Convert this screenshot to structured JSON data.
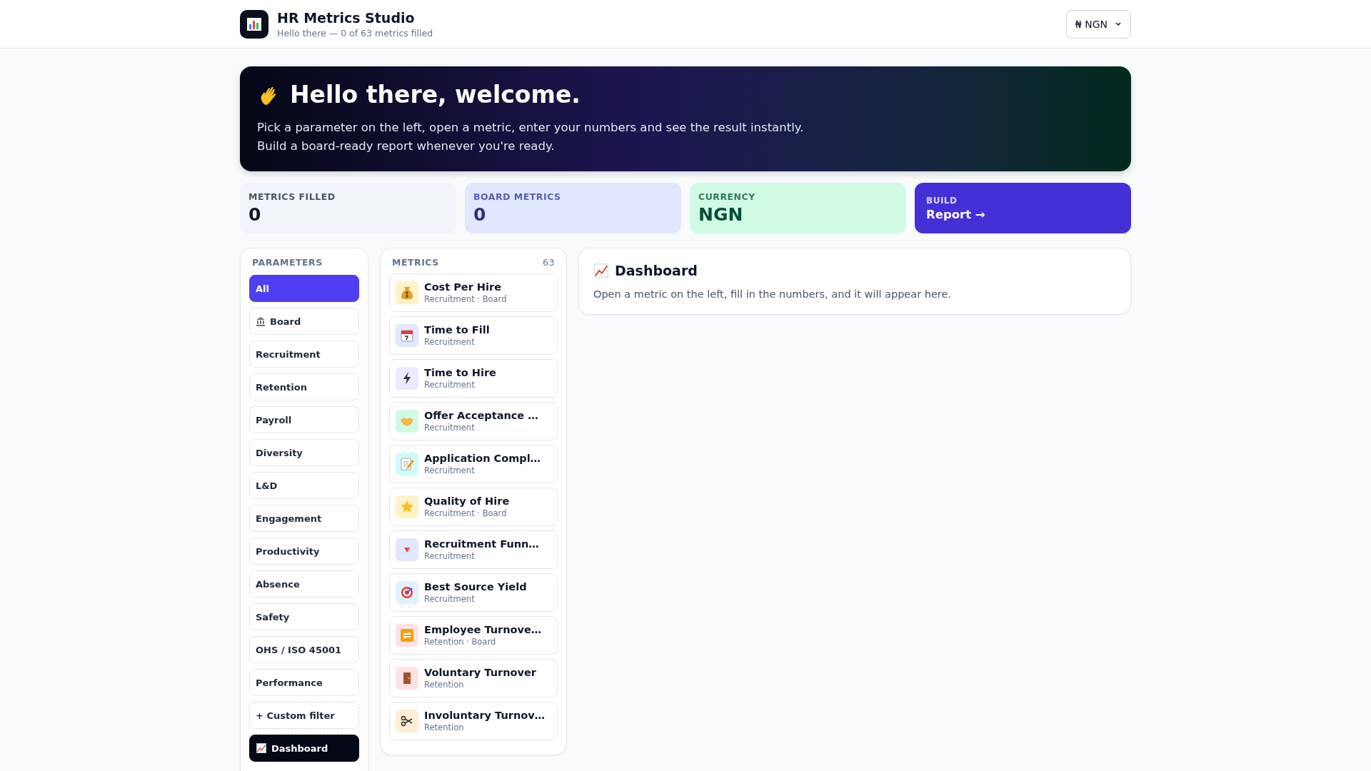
{
  "header": {
    "title": "HR Metrics Studio",
    "subtitle": "Hello there — 0 of 63 metrics filled",
    "currency_select": "₦ NGN"
  },
  "hero": {
    "title": "Hello there, welcome.",
    "lines": [
      "Pick a parameter on the left, open a metric, enter your numbers and see the result instantly.",
      "Build a board-ready report whenever you're ready."
    ]
  },
  "stats": [
    {
      "kind": "stat",
      "label": "METRICS FILLED",
      "value": "0"
    },
    {
      "kind": "stat",
      "label": "BOARD METRICS",
      "value": "0"
    },
    {
      "kind": "stat",
      "label": "CURRENCY",
      "value": "NGN"
    },
    {
      "kind": "action",
      "label": "BUILD",
      "value": "Report →"
    }
  ],
  "parameters": {
    "title": "PARAMETERS",
    "items": [
      {
        "label": "All",
        "selected": true
      },
      {
        "label": "Board",
        "selected": false
      },
      {
        "label": "Recruitment",
        "selected": false
      },
      {
        "label": "Retention",
        "selected": false
      },
      {
        "label": "Payroll",
        "selected": false
      },
      {
        "label": "Diversity",
        "selected": false
      },
      {
        "label": "L&D",
        "selected": false
      },
      {
        "label": "Engagement",
        "selected": false
      },
      {
        "label": "Productivity",
        "selected": false
      },
      {
        "label": "Absence",
        "selected": false
      },
      {
        "label": "Safety",
        "selected": false
      },
      {
        "label": "OHS / ISO 45001",
        "selected": false
      },
      {
        "label": "Performance",
        "selected": false
      }
    ],
    "custom_filter": "+ Custom filter",
    "dashboard_button": "Dashboard"
  },
  "metrics": {
    "title": "METRICS",
    "count": "63",
    "items": [
      {
        "name": "Cost Per Hire",
        "tags": "Recruitment · Board"
      },
      {
        "name": "Time to Fill",
        "tags": "Recruitment"
      },
      {
        "name": "Time to Hire",
        "tags": "Recruitment"
      },
      {
        "name": "Offer Acceptance …",
        "tags": "Recruitment"
      },
      {
        "name": "Application Compl…",
        "tags": "Recruitment"
      },
      {
        "name": "Quality of Hire",
        "tags": "Recruitment · Board"
      },
      {
        "name": "Recruitment Funn…",
        "tags": "Recruitment"
      },
      {
        "name": "Best Source Yield",
        "tags": "Recruitment"
      },
      {
        "name": "Employee Turnove…",
        "tags": "Retention · Board"
      },
      {
        "name": "Voluntary Turnover",
        "tags": "Retention"
      },
      {
        "name": "Involuntary Turnov…",
        "tags": "Retention"
      }
    ]
  },
  "dashboard": {
    "title": "Dashboard",
    "text": "Open a metric on the left, fill in the numbers, and it will appear here."
  }
}
